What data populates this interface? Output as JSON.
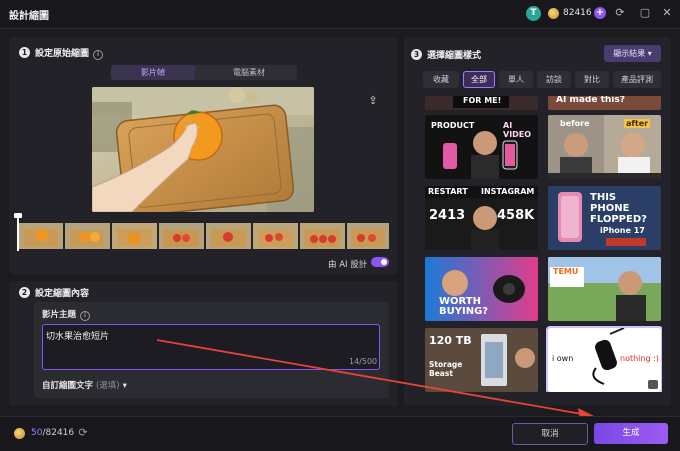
{
  "window": {
    "title": "設計縮圖",
    "avatar_letter": "T",
    "credits": "82416"
  },
  "left": {
    "step1": {
      "number": "1",
      "title": "設定原始縮圖",
      "tabs": [
        "影片幀",
        "電腦素材"
      ]
    },
    "ai_design_label": "由 AI 設計",
    "step2": {
      "number": "2",
      "title": "設定縮圖內容",
      "field_label": "影片主題",
      "field_value": "切水果治愈短片",
      "char_count": "14/500",
      "custom_label": "自訂縮圖文字",
      "custom_optional": "(選填)"
    }
  },
  "right": {
    "step3": {
      "number": "3",
      "title": "選擇縮圖樣式"
    },
    "show_results": "顯示結果",
    "filter_tabs": [
      "收藏",
      "全部",
      "單人",
      "訪談",
      "對比",
      "產品評測"
    ],
    "thumbnails": [
      {
        "id": "top-left",
        "text": "FOR ME!"
      },
      {
        "id": "top-right",
        "text": "AI made this?"
      },
      {
        "id": "product-ai-video",
        "text1": "PRODUCT",
        "text2": "AI VIDEO"
      },
      {
        "id": "before-after",
        "text1": "before",
        "text2": "after"
      },
      {
        "id": "restart-instagram",
        "text1": "RESTART",
        "text2": "INSTAGRAM",
        "n1": "2413",
        "n2": "458K"
      },
      {
        "id": "this-phone-flopped",
        "text1": "THIS PHONE FLOPPED?",
        "text2": "iPhone 17"
      },
      {
        "id": "worth-buying",
        "text1": "WORTH BUYING?"
      },
      {
        "id": "temu",
        "text1": "TEMU"
      },
      {
        "id": "120tb",
        "text1": "120 TB",
        "text2": "Storage Beast"
      },
      {
        "id": "i-own-nothing",
        "text1": "i own",
        "text2": "nothing :)"
      }
    ]
  },
  "footer": {
    "credits_used": "50",
    "credits_total": "/82416",
    "cancel": "取消",
    "generate": "生成"
  },
  "colors": {
    "accent": "#8a56f0",
    "bg": "#1b1b20",
    "panel": "#222228"
  }
}
